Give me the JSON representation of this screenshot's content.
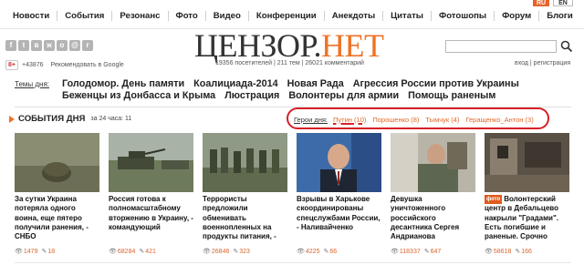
{
  "topnav": {
    "items": [
      "Новости",
      "События",
      "Резонанс",
      "Фото",
      "Видео",
      "Конференции",
      "Анекдоты",
      "Цитаты",
      "Фотошопы",
      "Форум",
      "Блоги"
    ],
    "lang_ru": "RU",
    "lang_en": "EN"
  },
  "header": {
    "logo_part1": "ЦЕНЗОР.",
    "logo_part2": "НЕТ",
    "stats": "19356 посетителей | 211 тем | 26021 комментарий",
    "gplus_badge": "8+",
    "gplus_count": "+43876",
    "gplus_text": "Рекомендовать в Google",
    "login_links": "вход | регистрация",
    "search_placeholder": ""
  },
  "topics": {
    "label": "Темы дня:",
    "row1": [
      "Голодомор. День памяти",
      "Коалициада-2014",
      "Новая Рада",
      "Агрессия России против Украины"
    ],
    "row2": [
      "Беженцы из Донбасса и Крыма",
      "Люстрация",
      "Волонтеры для армии",
      "Помощь раненым"
    ]
  },
  "events": {
    "title": "СОБЫТИЯ ДНЯ",
    "count": "за 24 часа: 11",
    "heroes_label": "Герои дня:",
    "heroes": [
      {
        "name": "Путин",
        "count": "(10)"
      },
      {
        "name": "Порошенко",
        "count": "(8)"
      },
      {
        "name": "Тымчук",
        "count": "(4)"
      },
      {
        "name": "Геращенко_Антон",
        "count": "(3)"
      }
    ]
  },
  "news": [
    {
      "title": "За сутки Украина потеряла одного воина, еще пятеро получили ранения, - СНБО",
      "views": "1479",
      "comments": "18"
    },
    {
      "title": "Россия готова к полномасштабному вторжению в Украину, - командующий",
      "views": "68284",
      "comments": "421"
    },
    {
      "title": "Террористы предложили обменивать военнопленных на продукты питания, -",
      "views": "26846",
      "comments": "323"
    },
    {
      "title": "Взрывы в Харькове скоординированы спецслужбами России, - Наливайченко",
      "views": "4225",
      "comments": "66"
    },
    {
      "title": "Девушка уничтоженного российского десантника Сергея Андрианова",
      "views": "118337",
      "comments": "647"
    },
    {
      "badge": "фото",
      "title": "Волонтерский центр в Дебальцево накрыли \"Градами\". Есть погибшие и раненые. Срочно",
      "views": "58618",
      "comments": "166"
    }
  ]
}
